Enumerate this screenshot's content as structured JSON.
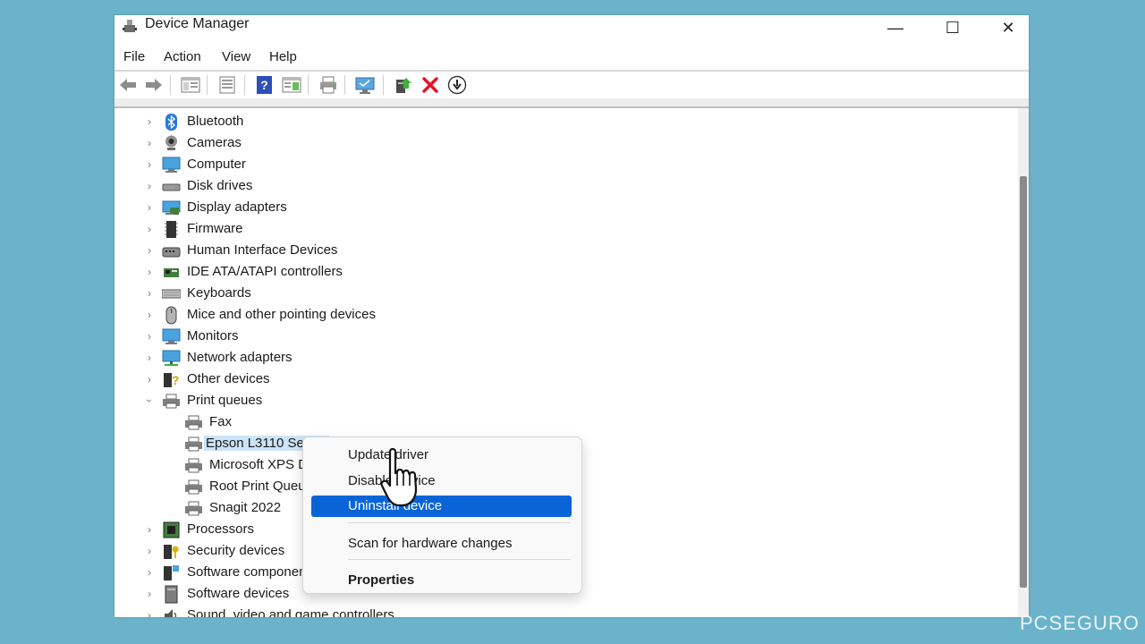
{
  "window": {
    "title": "Device Manager",
    "controls": {
      "minimize": "—",
      "maximize": "☐",
      "close": "✕"
    }
  },
  "menu": [
    "File",
    "Action",
    "View",
    "Help"
  ],
  "toolbar": {
    "icons": [
      "back-arrow-icon",
      "forward-arrow-icon",
      "show-hide-tree-icon",
      "properties-sheet-icon",
      "help-icon",
      "view-pane-icon",
      "print-icon",
      "scan-monitor-icon",
      "update-driver-icon",
      "uninstall-x-icon",
      "download-circle-icon"
    ]
  },
  "tree": {
    "categories": [
      {
        "label": "Bluetooth",
        "icon": "bluetooth-icon"
      },
      {
        "label": "Cameras",
        "icon": "camera-icon"
      },
      {
        "label": "Computer",
        "icon": "computer-icon"
      },
      {
        "label": "Disk drives",
        "icon": "disk-drive-icon"
      },
      {
        "label": "Display adapters",
        "icon": "display-adapter-icon"
      },
      {
        "label": "Firmware",
        "icon": "firmware-chip-icon"
      },
      {
        "label": "Human Interface Devices",
        "icon": "hid-icon"
      },
      {
        "label": "IDE ATA/ATAPI controllers",
        "icon": "ide-controller-icon"
      },
      {
        "label": "Keyboards",
        "icon": "keyboard-icon"
      },
      {
        "label": "Mice and other pointing devices",
        "icon": "mouse-icon"
      },
      {
        "label": "Monitors",
        "icon": "monitor-icon"
      },
      {
        "label": "Network adapters",
        "icon": "network-adapter-icon"
      },
      {
        "label": "Other devices",
        "icon": "other-devices-icon"
      },
      {
        "label": "Print queues",
        "icon": "printer-icon",
        "expanded": true
      }
    ],
    "print_queue_children": [
      {
        "label": "Fax"
      },
      {
        "label": "Epson L3110 Series",
        "selected": true
      },
      {
        "label": "Microsoft XPS Document Writer"
      },
      {
        "label": "Root Print Queue"
      },
      {
        "label": "Snagit 2022"
      }
    ],
    "categories_after": [
      {
        "label": "Processors",
        "icon": "processor-icon"
      },
      {
        "label": "Security devices",
        "icon": "security-device-icon"
      },
      {
        "label": "Software components",
        "icon": "software-component-icon"
      },
      {
        "label": "Software devices",
        "icon": "software-device-icon"
      },
      {
        "label": "Sound, video and game controllers",
        "icon": "speaker-icon"
      }
    ]
  },
  "context_menu": {
    "items": [
      "Update driver",
      "Disable device",
      "Uninstall device",
      "Scan for hardware changes",
      "Properties"
    ],
    "highlighted": "Uninstall device"
  },
  "watermark": "PCSEGURO",
  "colors": {
    "desktop": "#6ab3cb",
    "selection": "#cce4f7",
    "menu_highlight": "#0a64d8",
    "delete_red": "#e81123"
  }
}
